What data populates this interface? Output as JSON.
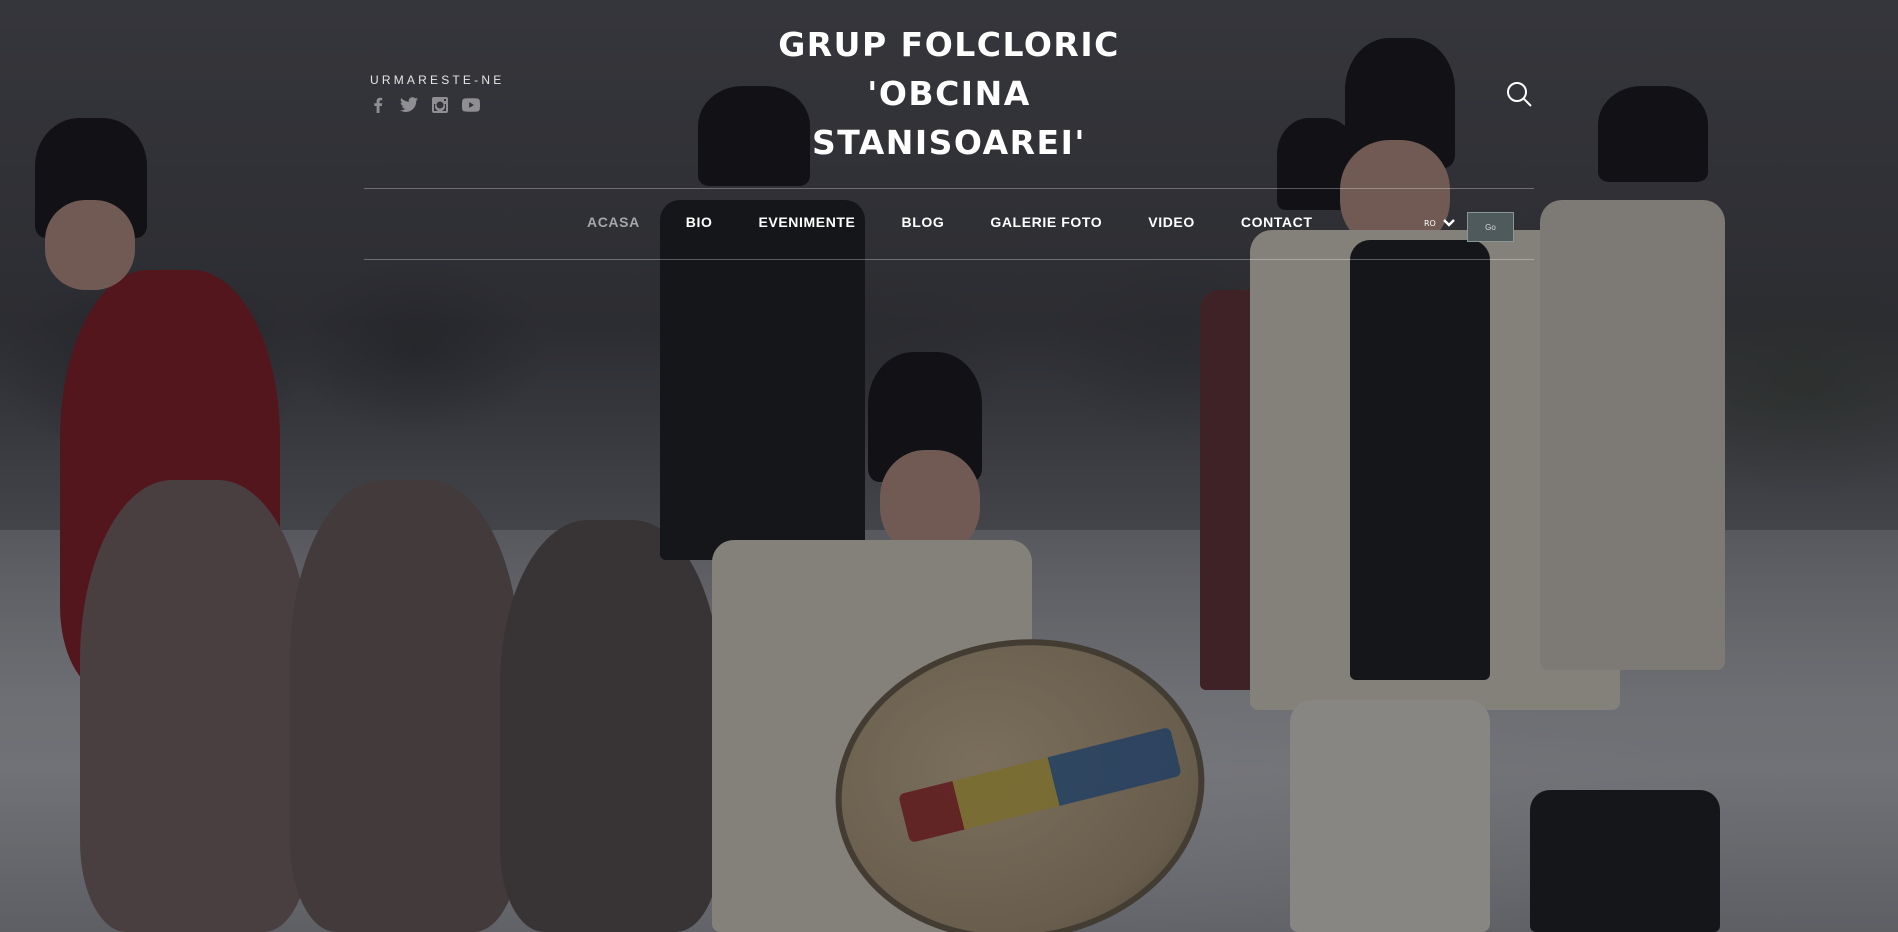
{
  "header": {
    "title_line1": "GRUP FOLCLORIC",
    "title_line2": "'OBCINA",
    "title_line3": "STANISOAREI'"
  },
  "follow": {
    "label": "URMARESTE-NE",
    "icons": [
      "facebook-icon",
      "twitter-icon",
      "instagram-icon",
      "youtube-icon"
    ]
  },
  "nav": {
    "items": [
      {
        "label": "ACASA",
        "active": true
      },
      {
        "label": "BIO"
      },
      {
        "label": "EVENIMENTE"
      },
      {
        "label": "BLOG"
      },
      {
        "label": "GALERIE FOTO"
      },
      {
        "label": "VIDEO"
      },
      {
        "label": "CONTACT"
      }
    ]
  },
  "language": {
    "selected": "RO",
    "go_label": "Go"
  },
  "search": {
    "icon": "search-icon"
  },
  "colors": {
    "text": "#ffffff",
    "active_nav": "#a6a6aa",
    "social_icon": "#8f8f93",
    "go_button": "#4e5a5c"
  }
}
